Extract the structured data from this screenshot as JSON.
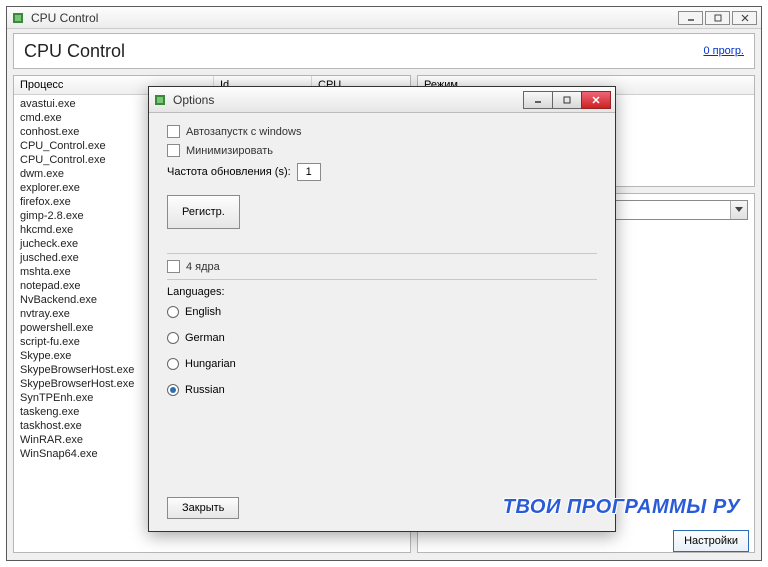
{
  "main": {
    "title": "CPU Control",
    "header_title": "CPU Control",
    "header_link": "0 прогр.",
    "columns": {
      "process": "Процесс",
      "id": "Id",
      "cpu": "CPU"
    },
    "processes": [
      "avastui.exe",
      "cmd.exe",
      "conhost.exe",
      "CPU_Control.exe",
      "CPU_Control.exe",
      "dwm.exe",
      "explorer.exe",
      "firefox.exe",
      "gimp-2.8.exe",
      "hkcmd.exe",
      "jucheck.exe",
      "jusched.exe",
      "mshta.exe",
      "notepad.exe",
      "NvBackend.exe",
      "nvtray.exe",
      "powershell.exe",
      "script-fu.exe",
      "Skype.exe",
      "SkypeBrowserHost.exe",
      "SkypeBrowserHost.exe",
      "SynTPEnh.exe",
      "taskeng.exe",
      "taskhost.exe",
      "WinRAR.exe",
      "WinSnap64.exe"
    ],
    "mode_label": "Режим",
    "settings_button": "Настройки"
  },
  "options": {
    "title": "Options",
    "autostart": "Автозапустк c windows",
    "minimize": "Минимизировать",
    "freq_label": "Частота обновления (s):",
    "freq_value": "1",
    "register": "Регистр.",
    "four_cores": "4 ядра",
    "languages_label": "Languages:",
    "langs": {
      "en": "English",
      "de": "German",
      "hu": "Hungarian",
      "ru": "Russian"
    },
    "selected_lang": "ru",
    "close": "Закрыть"
  },
  "watermark": "ТВОИ ПРОГРАММЫ РУ"
}
